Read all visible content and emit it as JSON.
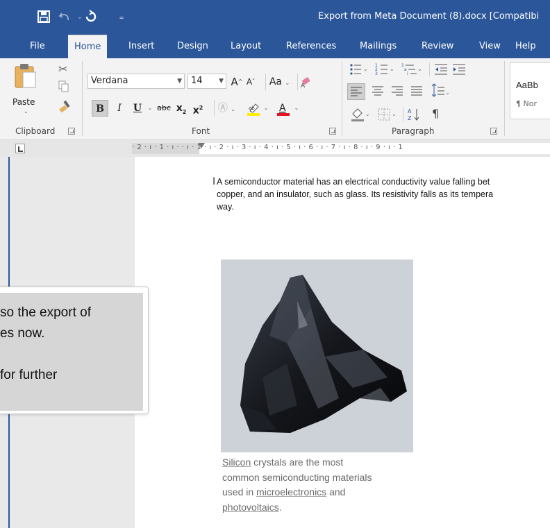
{
  "title_bar": {
    "document_title": "Export from Meta Document (8).docx [Compatibi",
    "icons": [
      "save-icon",
      "undo-icon",
      "redo-icon",
      "customize-qat-icon"
    ]
  },
  "tabs": [
    {
      "label": "File"
    },
    {
      "label": "Home",
      "active": true
    },
    {
      "label": "Insert"
    },
    {
      "label": "Design"
    },
    {
      "label": "Layout"
    },
    {
      "label": "References"
    },
    {
      "label": "Mailings"
    },
    {
      "label": "Review"
    },
    {
      "label": "View"
    },
    {
      "label": "Help"
    }
  ],
  "ribbon": {
    "clipboard": {
      "paste_label": "Paste",
      "group_label": "Clipboard"
    },
    "font": {
      "font_name": "Verdana",
      "font_size": "14",
      "grow": "A",
      "shrink": "A",
      "change_case": "Aa",
      "bold": "B",
      "italic": "I",
      "underline": "U",
      "strike": "abc",
      "subscript": "x",
      "superscript": "x",
      "group_label": "Font"
    },
    "paragraph": {
      "group_label": "Paragraph"
    },
    "styles": {
      "preview": "AaBb",
      "name_preview": "¶ Nor"
    }
  },
  "ruler": {
    "text": "· 2 · ı · 1 · ı ·   · ı · 1 · ı · 2 · ı · 3 · ı · 4 · ı · 5 · ı · 6 · ı · 7 · ı · 8 · ı · 9 · ı · 1"
  },
  "document": {
    "paragraph_lines": [
      "A semiconductor material has an electrical conductivity value falling bet",
      "copper, and an insulator, such as glass. Its resistivity falls as its tempera",
      "way."
    ],
    "caption": {
      "line1_link": "Silicon",
      "line1_rest": " crystals are the most",
      "line2": "common semiconducting materials",
      "line3_pre": "used in ",
      "line3_link": "microelectronics",
      "line3_post": " and",
      "line4_link": "photovoltaics",
      "line4_post": "."
    }
  },
  "popup": {
    "lines": [
      "so the export of",
      "es now.",
      "",
      "for further"
    ]
  },
  "colors": {
    "accent": "#2b579a",
    "ribbon_bg": "#f3f3f3",
    "font_color_bar": "#e81123",
    "highlight_bar": "#ffee00"
  }
}
